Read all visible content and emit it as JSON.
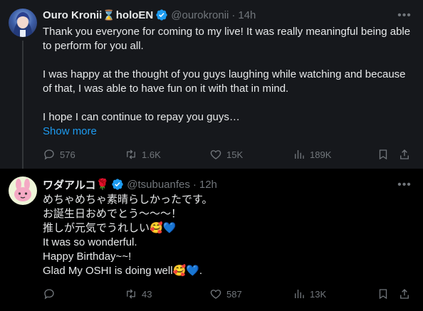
{
  "tweets": [
    {
      "display_name": "Ouro Kronii",
      "name_suffix": "holoEN",
      "hourglass_icon": "⌛",
      "handle": "@ourokronii",
      "dot": "·",
      "time": "14h",
      "paragraphs": [
        "Thank you everyone for coming to my live! It was really meaningful being able to perform for you all.",
        "I was happy at the thought of you guys laughing while watching and because of that, I was able to have fun on it with that in mind.",
        "I hope I can continue to repay you guys…"
      ],
      "show_more": "Show more",
      "stats": {
        "replies": "576",
        "reposts": "1.6K",
        "likes": "15K",
        "views": "189K"
      }
    },
    {
      "display_name": "ワダアルコ",
      "name_emoji": "🌹",
      "handle": "@tsubuanfes",
      "dot": "·",
      "time": "12h",
      "lines": [
        "めちゃめちゃ素晴らしかったです。",
        "お誕生日おめでとう〜〜〜！",
        "推しが元気でうれしい🥰💙",
        "It was so wonderful.",
        "Happy Birthday~~!",
        "Glad My OSHI is doing well🥰💙."
      ],
      "stats": {
        "replies": "",
        "reposts": "43",
        "likes": "587",
        "views": "13K"
      }
    }
  ],
  "colors": {
    "accent": "#1d9bf0",
    "muted": "#71767b",
    "text": "#e7e9ea",
    "highlight_bg": "#16181c",
    "background": "#000000"
  },
  "icons": [
    "more-icon",
    "verified-badge-icon",
    "reply-icon",
    "repost-icon",
    "like-icon",
    "views-icon",
    "bookmark-icon",
    "share-icon"
  ]
}
